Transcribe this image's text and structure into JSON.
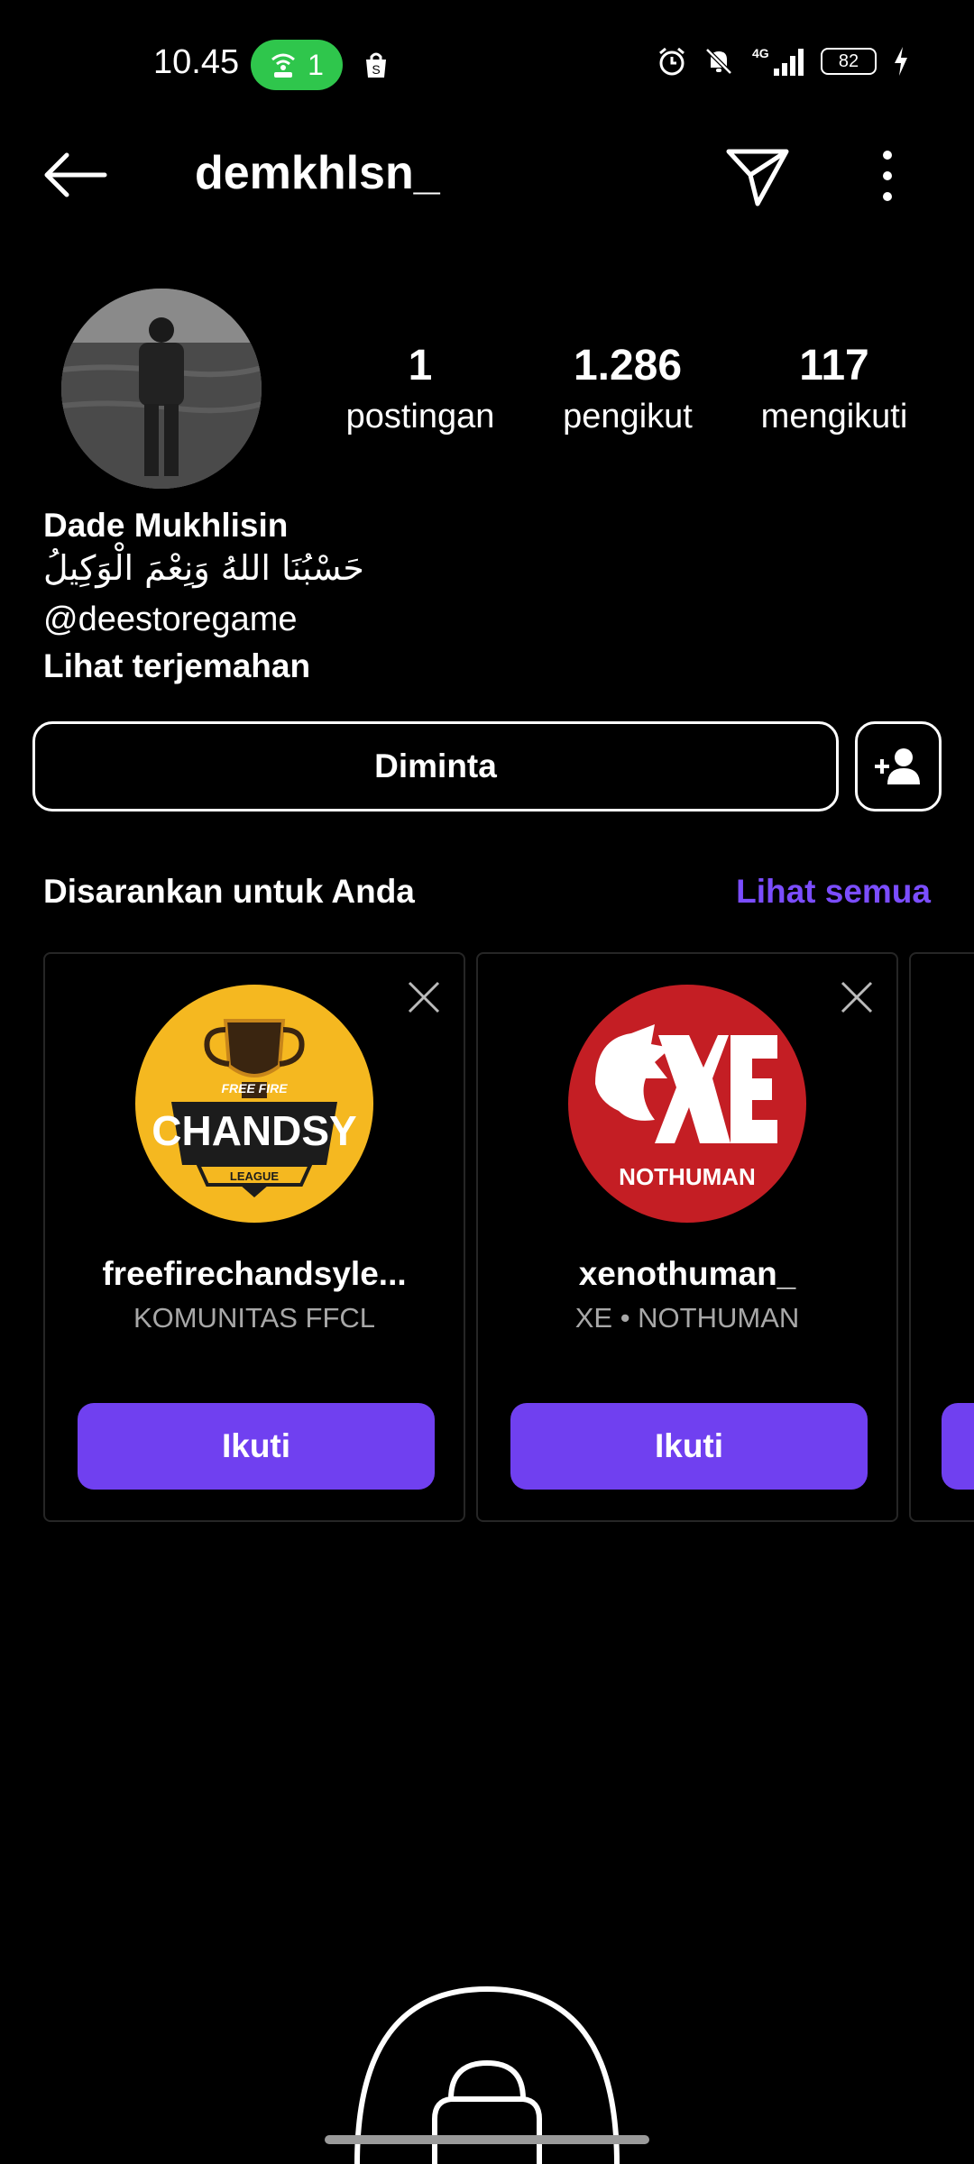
{
  "status_bar": {
    "time": "10.45",
    "hotspot_count": "1",
    "battery": "82",
    "network": "4G"
  },
  "header": {
    "username": "demkhlsn_"
  },
  "profile": {
    "stats": [
      {
        "value": "1",
        "label": "postingan"
      },
      {
        "value": "1.286",
        "label": "pengikut"
      },
      {
        "value": "117",
        "label": "mengikuti"
      }
    ],
    "name": "Dade Mukhlisin",
    "bio": "حَسْبُنَا اللهُ وَنِعْمَ الْوَكِيلُ",
    "link": "@deestoregame",
    "translate_label": "Lihat terjemahan",
    "requested_label": "Diminta"
  },
  "suggestions": {
    "title": "Disarankan untuk Anda",
    "see_all": "Lihat semua",
    "cards": [
      {
        "username": "freefirechandsyle...",
        "subtitle": "KOMUNITAS FFCL",
        "follow_label": "Ikuti",
        "logo_text": "CHANDSY"
      },
      {
        "username": "xenothuman_",
        "subtitle": "XE • NOTHUMAN",
        "follow_label": "Ikuti",
        "logo_text": "NOTHUMAN"
      }
    ]
  },
  "colors": {
    "accent": "#7040f0",
    "link": "#7b4dff",
    "hotspot": "#2fc64c"
  }
}
